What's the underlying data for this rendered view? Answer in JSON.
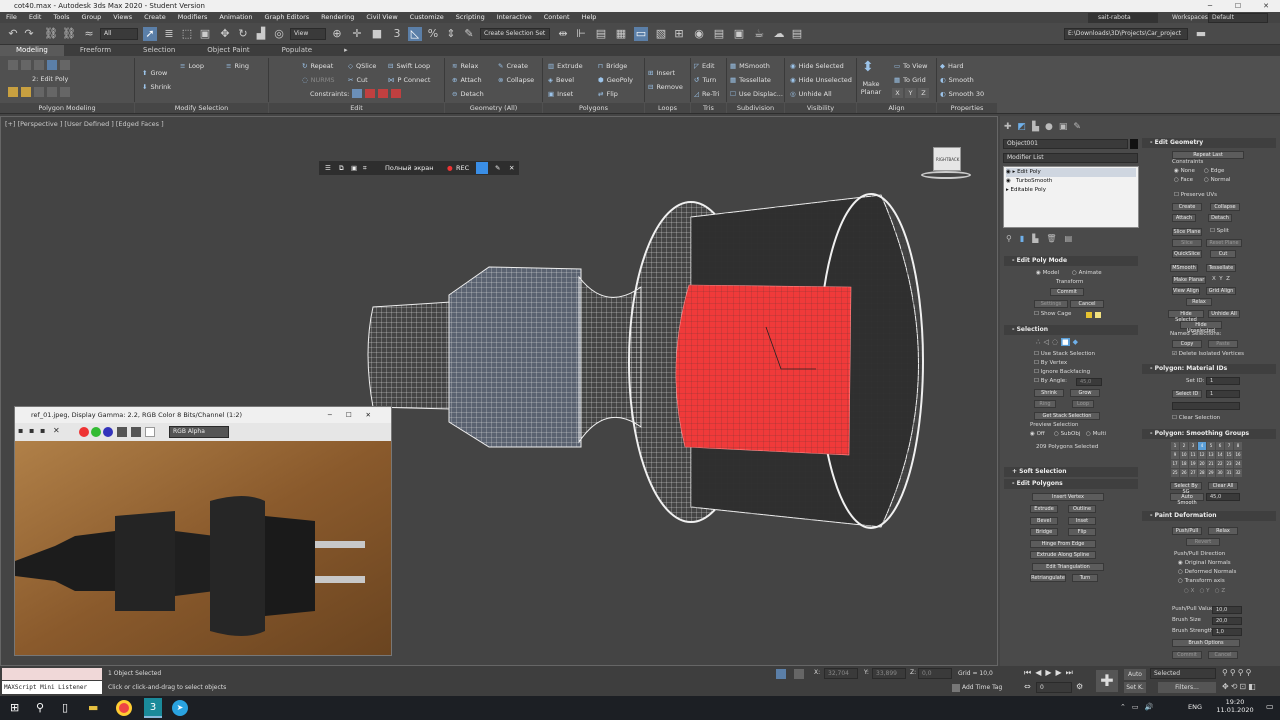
{
  "window": {
    "title": "cot40.max - Autodesk 3ds Max 2020 - Student Version"
  },
  "menu": [
    "File",
    "Edit",
    "Tools",
    "Group",
    "Views",
    "Create",
    "Modifiers",
    "Animation",
    "Graph Editors",
    "Rendering",
    "Civil View",
    "Customize",
    "Scripting",
    "Interactive",
    "Content",
    "Help"
  ],
  "user": {
    "name": "sait-rabota",
    "workspaces_label": "Workspaces:",
    "workspace": "Default"
  },
  "toolbar": {
    "filter": "All",
    "coord": "View",
    "selection_set": "Create Selection Set"
  },
  "path": "E:\\Downloads\\3D\\Projects\\Car_project",
  "ribbon_tabs": [
    "Modeling",
    "Freeform",
    "Selection",
    "Object Paint",
    "Populate"
  ],
  "ribbon": {
    "edit_poly": "2: Edit Poly",
    "grow": "Grow",
    "shrink": "Shrink",
    "loop": "Loop",
    "ring": "Ring",
    "repeat": "Repeat",
    "qslice": "QSlice",
    "swift_loop": "Swift Loop",
    "nurms": "NURMS",
    "cut": "Cut",
    "p_connect": "P Connect",
    "constraints": "Constraints:",
    "relax": "Relax",
    "create": "Create",
    "attach": "Attach",
    "collapse": "Collapse",
    "detach": "Detach",
    "extrude": "Extrude",
    "bridge": "Bridge",
    "bevel": "Bevel",
    "geopoly": "GeoPoly",
    "inset": "Inset",
    "flip": "Flip",
    "insert": "Insert",
    "remove": "Remove",
    "edit": "Edit",
    "turn": "Turn",
    "retri": "Re-Tri",
    "msmooth": "MSmooth",
    "tessellate": "Tessellate",
    "use_displac": "Use Displac...",
    "hide_selected": "Hide Selected",
    "hide_unselected": "Hide Unselected",
    "unhide_all": "Unhide All",
    "make_planar": "Make Planar",
    "to_view": "To View",
    "to_grid": "To Grid",
    "hard": "Hard",
    "smooth": "Smooth",
    "smooth30": "Smooth 30",
    "sections": [
      "Polygon Modeling",
      "Modify Selection",
      "Edit",
      "Geometry (All)",
      "Polygons",
      "Loops",
      "Tris",
      "Subdivision",
      "Visibility",
      "Align",
      "Properties"
    ]
  },
  "viewport": {
    "label": "[+] [Perspective ] [User Defined ] [Edged Faces ]",
    "fullscreen": "Полный экран",
    "rec": "REC"
  },
  "viewcube": {
    "left": "RIGHT",
    "right": "BACK"
  },
  "image_window": {
    "title": "ref_01.jpeg, Display Gamma: 2.2, RGB Color 8 Bits/Channel (1:2)",
    "channel": "RGB Alpha"
  },
  "modifier_panel": {
    "object": "Object001",
    "modifier_list": "Modifier List",
    "stack": [
      "Edit Poly",
      "TurboSmooth",
      "Editable Poly"
    ],
    "edit_poly_mode": "Edit Poly Mode",
    "model": "Model",
    "animate": "Animate",
    "transform": "Transform",
    "commit": "Commit",
    "settings": "Settings",
    "cancel": "Cancel",
    "show_cage": "Show Cage",
    "selection": "Selection",
    "use_stack": "Use Stack Selection",
    "by_vertex": "By Vertex",
    "ignore_backfacing": "Ignore Backfacing",
    "by_angle": "By Angle:",
    "angle_val": "45,0",
    "shrink": "Shrink",
    "grow": "Grow",
    "ring": "Ring",
    "loop": "Loop",
    "get_stack": "Get Stack Selection",
    "preview_selection": "Preview Selection",
    "off": "Off",
    "subobj": "SubObj",
    "multi": "Multi",
    "polys_selected": "209 Polygons Selected",
    "soft_selection": "Soft Selection",
    "edit_polygons": "Edit Polygons",
    "insert_vertex": "Insert Vertex",
    "extrude": "Extrude",
    "outline": "Outline",
    "bevel": "Bevel",
    "inset": "Inset",
    "bridge": "Bridge",
    "flip": "Flip",
    "hinge": "Hinge From Edge",
    "extrude_spline": "Extrude Along Spline",
    "edit_tri": "Edit Triangulation",
    "retriangulate": "Retriangulate",
    "turn": "Turn"
  },
  "geom_panel": {
    "edit_geometry": "Edit Geometry",
    "repeat_last": "Repeat Last",
    "constraints": "Constraints",
    "none": "None",
    "edge": "Edge",
    "face": "Face",
    "normal": "Normal",
    "preserve_uvs": "Preserve UVs",
    "create": "Create",
    "collapse": "Collapse",
    "attach": "Attach",
    "detach": "Detach",
    "slice_plane": "Slice Plane",
    "split": "Split",
    "slice": "Slice",
    "reset_plane": "Reset Plane",
    "quickslice": "QuickSlice",
    "cut": "Cut",
    "msmooth": "MSmooth",
    "tessellate": "Tessellate",
    "make_planar": "Make Planar",
    "x": "X",
    "y": "Y",
    "z": "Z",
    "view_align": "View Align",
    "grid_align": "Grid Align",
    "relax": "Relax",
    "hide_selected": "Hide Selected",
    "unhide_all": "Unhide All",
    "hide_unselected": "Hide Unselected",
    "named_selections": "Named Selections:",
    "copy": "Copy",
    "paste": "Paste",
    "delete_isolated": "Delete Isolated Vertices",
    "material_ids": "Polygon: Material IDs",
    "set_id": "Set ID:",
    "set_id_val": "1",
    "select_id": "Select ID",
    "select_id_val": "1",
    "clear_selection": "Clear Selection",
    "smoothing_groups": "Polygon: Smoothing Groups",
    "sg": [
      "1",
      "2",
      "3",
      "4",
      "5",
      "6",
      "7",
      "8",
      "9",
      "10",
      "11",
      "12",
      "13",
      "14",
      "15",
      "16",
      "17",
      "18",
      "19",
      "20",
      "21",
      "22",
      "23",
      "24",
      "25",
      "26",
      "27",
      "28",
      "29",
      "30",
      "31",
      "32"
    ],
    "select_by_sg": "Select By SG",
    "clear_all": "Clear All",
    "auto_smooth": "Auto Smooth",
    "auto_val": "45,0",
    "paint_deformation": "Paint Deformation",
    "push_pull": "Push/Pull",
    "relax2": "Relax",
    "revert": "Revert",
    "push_pull_dir": "Push/Pull Direction",
    "original_normals": "Original Normals",
    "deformed_normals": "Deformed Normals",
    "transform_axis": "Transform axis",
    "pp_value": "Push/Pull Value",
    "pp_val": "10,0",
    "brush_size": "Brush Size",
    "bs_val": "20,0",
    "brush_strength": "Brush Strength",
    "bst_val": "1,0",
    "brush_options": "Brush Options",
    "commit": "Commit",
    "cancel": "Cancel"
  },
  "status": {
    "listener": "MAXScript Mini Listener",
    "selected": "1 Object Selected",
    "prompt": "Click or click-and-drag to select objects",
    "x": "32,704",
    "y": "33,899",
    "z": "0,0",
    "grid": "Grid = 10,0",
    "add_time_tag": "Add Time Tag",
    "auto": "Auto",
    "selected_dd": "Selected",
    "set_k": "Set K.",
    "filters": "Filters...",
    "frame": "0"
  },
  "taskbar": {
    "lang": "ENG",
    "time": "19:20",
    "date": "11.01.2020"
  }
}
